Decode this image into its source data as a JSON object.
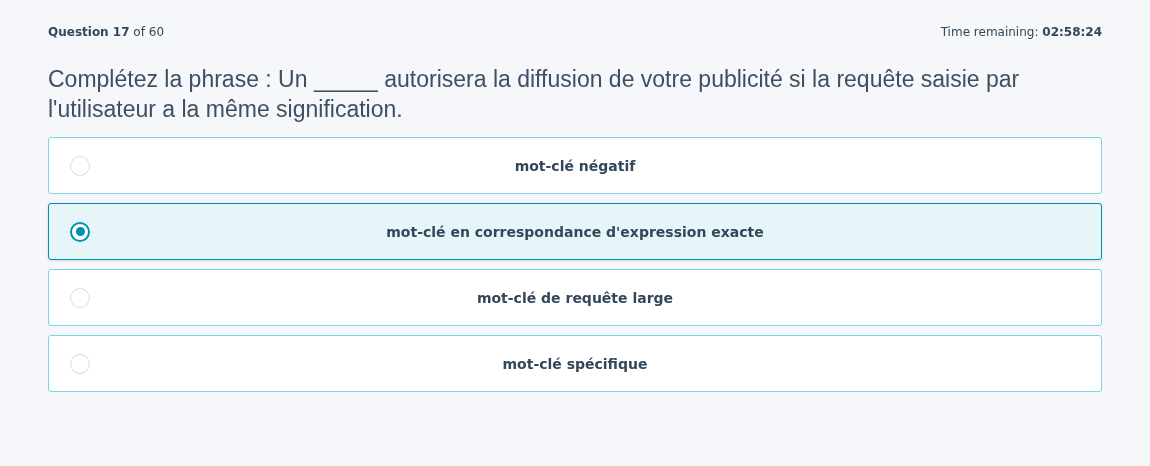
{
  "header": {
    "progress": "**Question 17** of 60",
    "timer": "Time remaining: **02:58:24**"
  },
  "question": "Complétez la phrase : Un _____ autorisera la diffusion de votre publicité si la requête saisie par l'utilisateur a la même signification.",
  "options": [
    {
      "label": "mot-clé négatif",
      "selected": false
    },
    {
      "label": "mot-clé en correspondance d'expression exacte",
      "selected": true
    },
    {
      "label": "mot-clé de requête large",
      "selected": false
    },
    {
      "label": "mot-clé spécifique",
      "selected": false
    }
  ]
}
